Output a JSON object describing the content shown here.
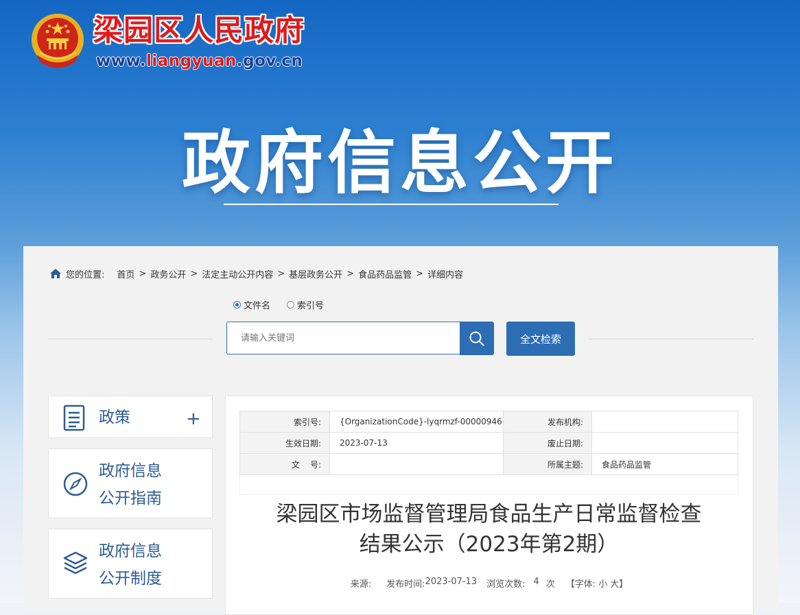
{
  "header": {
    "site_name": "梁园区人民政府",
    "url_prefix": "www.",
    "url_mid": "liangyuan",
    "url_suffix": ".gov.cn",
    "hero_title": "政府信息公开"
  },
  "breadcrumb": {
    "label": "您的位置:",
    "items": [
      "首页",
      "政务公开",
      "法定主动公开内容",
      "基层政务公开",
      "食品药品监管",
      "详细内容"
    ],
    "sep": ">"
  },
  "search": {
    "radio_options": [
      "文件名",
      "索引号"
    ],
    "selected": "文件名",
    "placeholder": "请输入关键词",
    "fulltext_label": "全文检索"
  },
  "sidebar": {
    "items": [
      {
        "label_line1": "政策",
        "label_line2": "",
        "icon": "document-icon"
      },
      {
        "label_line1": "政府信息",
        "label_line2": "公开指南",
        "icon": "compass-icon"
      },
      {
        "label_line1": "政府信息",
        "label_line2": "公开制度",
        "icon": "layers-icon"
      }
    ],
    "plus": "+"
  },
  "meta": {
    "index_no_label": "索引号:",
    "index_no": "{OrganizationCode}-lyqrmzf-00000946",
    "publisher_label": "发布机构:",
    "publisher": "",
    "effective_label": "生效日期:",
    "effective": "2023-07-13",
    "abolish_label": "废止日期:",
    "abolish": "",
    "docno_label": "文    号:",
    "docno": "",
    "topic_label": "所属主题:",
    "topic": "食品药品监管"
  },
  "article": {
    "title_line1": "梁园区市场监督管理局食品生产日常监督检查",
    "title_line2": "结果公示（2023年第2期）",
    "source_label": "来源:",
    "publish_label": "发布时间:",
    "publish_date": "2023-07-13",
    "views_label": "浏览次数:",
    "views": "4",
    "views_unit": "次",
    "font_label": "【字体:",
    "font_small": "小",
    "font_big": "大",
    "font_close": "】"
  },
  "colors": {
    "primary": "#2d6db4",
    "site_red": "#e01a1a",
    "nav_text": "#2d5b94"
  }
}
